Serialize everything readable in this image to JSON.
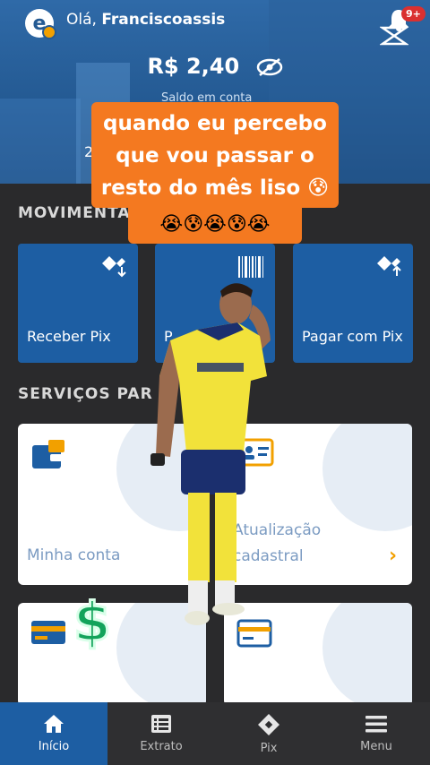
{
  "header": {
    "greeting": "Olá,",
    "user_name": "Franciscoassis",
    "notification_badge": "9+",
    "balance": "R$ 2,40",
    "balance_label": "Saldo em conta",
    "obscured_left_fragment": "2"
  },
  "meme": {
    "caption": "quando eu percebo que vou passar o resto do mês liso 😰",
    "emoji_row": "😭😰😭😰😭",
    "dollar_sticker": "$"
  },
  "sections": {
    "movimentacao_title": "MOVIMENTA",
    "servicos_title": "SERVIÇOS PAR"
  },
  "tiles": [
    {
      "label": "Receber Pix",
      "icon": "pix-receive-icon"
    },
    {
      "label": "P",
      "icon": "barcode-icon"
    },
    {
      "label": "Pagar com Pix",
      "icon": "pix-pay-icon"
    }
  ],
  "cards": [
    {
      "label": "Minha conta",
      "icon": "wallet-icon"
    },
    {
      "label_line1": "Atualização",
      "label_line2": "cadastral",
      "icon": "id-card-icon"
    },
    {
      "label": "",
      "icon": "credit-card-icon"
    },
    {
      "label": "",
      "icon": "card-icon"
    }
  ],
  "nav": [
    {
      "label": "Início",
      "icon": "home-icon",
      "active": true
    },
    {
      "label": "Extrato",
      "icon": "statement-icon",
      "active": false
    },
    {
      "label": "Pix",
      "icon": "pix-icon",
      "active": false
    },
    {
      "label": "Menu",
      "icon": "hamburger-menu-icon",
      "active": false
    }
  ],
  "colors": {
    "brand_blue": "#1d5ea3",
    "caption_orange": "#f47920",
    "accent_yellow": "#f2a000"
  }
}
